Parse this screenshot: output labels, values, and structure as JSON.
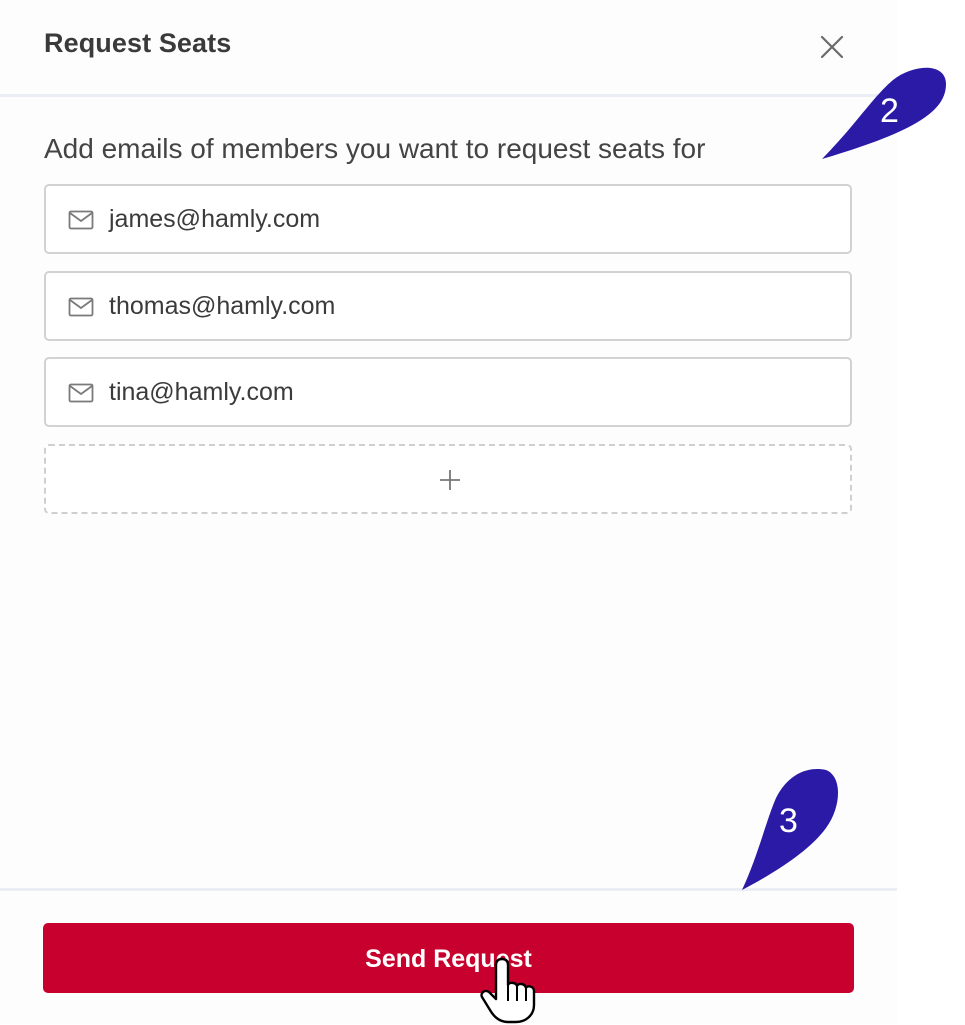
{
  "dialog": {
    "title": "Request Seats",
    "subtitle": "Add emails of members you want to request seats for",
    "emails": [
      "james@hamly.com",
      "thomas@hamly.com",
      "tina@hamly.com"
    ],
    "send_label": "Send Request"
  },
  "markers": {
    "step2": "2",
    "step3": "3"
  },
  "icons": {
    "close": "close-icon",
    "mail": "mail-icon",
    "add": "plus-icon",
    "cursor": "hand-pointer-icon"
  },
  "colors": {
    "primary": "#c8002d",
    "marker": "#2b1aa6",
    "border": "#d2d2d2",
    "text": "#3a3a3a"
  }
}
